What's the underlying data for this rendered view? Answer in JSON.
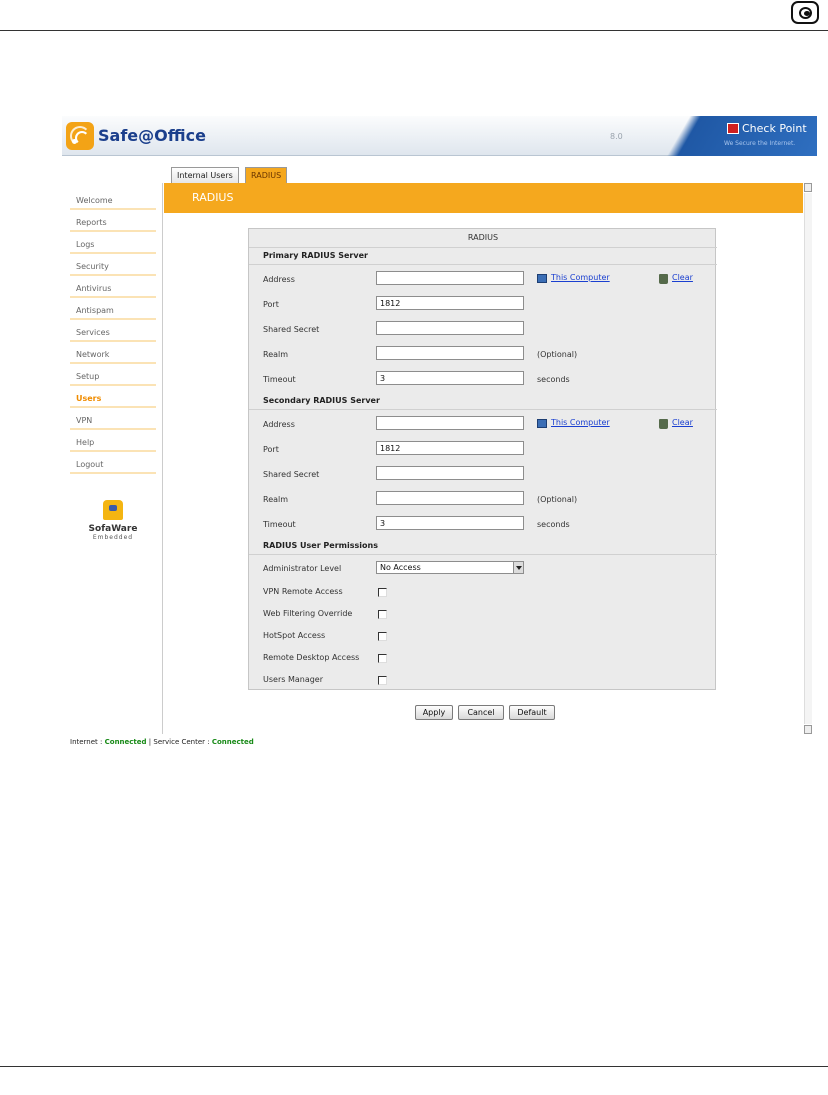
{
  "app": {
    "name": "Safe@Office",
    "version": "8.0",
    "vendor": "Check Point",
    "vendor_tagline": "We Secure the Internet."
  },
  "tabs": [
    {
      "label": "Internal Users",
      "active": false
    },
    {
      "label": "RADIUS",
      "active": true
    }
  ],
  "page_title": "RADIUS",
  "nav": [
    {
      "label": "Welcome"
    },
    {
      "label": "Reports"
    },
    {
      "label": "Logs"
    },
    {
      "label": "Security"
    },
    {
      "label": "Antivirus"
    },
    {
      "label": "Antispam"
    },
    {
      "label": "Services"
    },
    {
      "label": "Network"
    },
    {
      "label": "Setup"
    },
    {
      "label": "Users",
      "active": true
    },
    {
      "label": "VPN"
    },
    {
      "label": "Help"
    },
    {
      "label": "Logout"
    }
  ],
  "sofaware": {
    "name": "SofaWare",
    "sub": "Embedded"
  },
  "form": {
    "title": "RADIUS",
    "primary": {
      "heading": "Primary RADIUS Server",
      "labels": {
        "address": "Address",
        "port": "Port",
        "secret": "Shared Secret",
        "realm": "Realm",
        "timeout": "Timeout"
      },
      "values": {
        "address": "",
        "port": "1812",
        "secret": "",
        "realm": "",
        "timeout": "3"
      },
      "this_computer": "This Computer",
      "clear": "Clear",
      "optional": "(Optional)",
      "seconds": "seconds"
    },
    "secondary": {
      "heading": "Secondary RADIUS Server",
      "labels": {
        "address": "Address",
        "port": "Port",
        "secret": "Shared Secret",
        "realm": "Realm",
        "timeout": "Timeout"
      },
      "values": {
        "address": "",
        "port": "1812",
        "secret": "",
        "realm": "",
        "timeout": "3"
      },
      "this_computer": "This Computer",
      "clear": "Clear",
      "optional": "(Optional)",
      "seconds": "seconds"
    },
    "permissions": {
      "heading": "RADIUS User Permissions",
      "admin_level_label": "Administrator Level",
      "admin_level_value": "No Access",
      "checks": [
        {
          "label": "VPN Remote Access",
          "checked": false
        },
        {
          "label": "Web Filtering Override",
          "checked": false
        },
        {
          "label": "HotSpot Access",
          "checked": false
        },
        {
          "label": "Remote Desktop Access",
          "checked": false
        },
        {
          "label": "Users Manager",
          "checked": false
        }
      ]
    }
  },
  "buttons": {
    "apply": "Apply",
    "cancel": "Cancel",
    "default": "Default"
  },
  "status": {
    "internet_label": "Internet :",
    "internet_value": "Connected",
    "separator": "|",
    "service_label": "Service Center :",
    "service_value": "Connected"
  },
  "colors": {
    "accent": "#f5a81e",
    "link": "#1a3fd0",
    "connected": "#188a17",
    "brand": "#1b3f8c"
  }
}
